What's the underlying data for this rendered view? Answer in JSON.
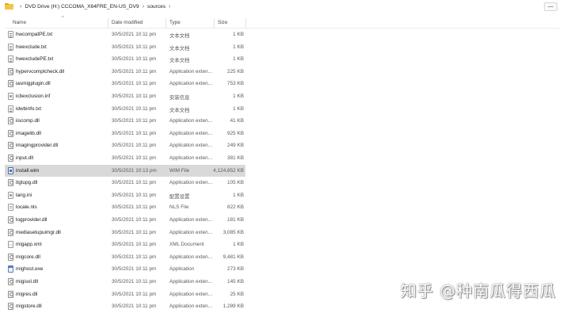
{
  "breadcrumb": {
    "items": [
      "DVD Drive (H:) CCCOMA_X64FRE_EN-US_DV9",
      "sources"
    ]
  },
  "window_buttons": [
    "—"
  ],
  "columns": {
    "name": "Name",
    "date": "Date modified",
    "type": "Type",
    "size": "Size"
  },
  "files": [
    {
      "name": "hwcompatPE.txt",
      "date": "30/5/2021 10:11 pm",
      "type": "文本文档",
      "size": "1 KB",
      "icon": "txt"
    },
    {
      "name": "hwexclude.txt",
      "date": "30/5/2021 10:11 pm",
      "type": "文本文档",
      "size": "1 KB",
      "icon": "txt"
    },
    {
      "name": "hwexcludePE.txt",
      "date": "30/5/2021 10:11 pm",
      "type": "文本文档",
      "size": "1 KB",
      "icon": "txt"
    },
    {
      "name": "hypervcomplcheck.dll",
      "date": "30/5/2021 10:11 pm",
      "type": "Application exten...",
      "size": "225 KB",
      "icon": "dll"
    },
    {
      "name": "iasmigplugin.dll",
      "date": "30/5/2021 10:11 pm",
      "type": "Application exten...",
      "size": "753 KB",
      "icon": "dll"
    },
    {
      "name": "icbexclusion.inf",
      "date": "30/5/2021 10:11 pm",
      "type": "安装信息",
      "size": "1 KB",
      "icon": "ini"
    },
    {
      "name": "idwbinfo.txt",
      "date": "30/5/2021 10:11 pm",
      "type": "文本文档",
      "size": "1 KB",
      "icon": "txt"
    },
    {
      "name": "iiscomp.dll",
      "date": "30/5/2021 10:11 pm",
      "type": "Application exten...",
      "size": "41 KB",
      "icon": "dll"
    },
    {
      "name": "imagelib.dll",
      "date": "30/5/2021 10:11 pm",
      "type": "Application exten...",
      "size": "925 KB",
      "icon": "dll"
    },
    {
      "name": "imagingprovider.dll",
      "date": "30/5/2021 10:11 pm",
      "type": "Application exten...",
      "size": "249 KB",
      "icon": "dll"
    },
    {
      "name": "input.dll",
      "date": "30/5/2021 10:11 pm",
      "type": "Application exten...",
      "size": "381 KB",
      "icon": "dll"
    },
    {
      "name": "install.wim",
      "date": "30/5/2021 10:13 pm",
      "type": "WIM File",
      "size": "4,124,652 KB",
      "icon": "wim",
      "selected": true
    },
    {
      "name": "itgtupg.dll",
      "date": "30/5/2021 10:11 pm",
      "type": "Application exten...",
      "size": "105 KB",
      "icon": "dll"
    },
    {
      "name": "lang.ini",
      "date": "30/5/2021 10:11 pm",
      "type": "配置设置",
      "size": "1 KB",
      "icon": "ini"
    },
    {
      "name": "locale.nls",
      "date": "30/5/2021 10:11 pm",
      "type": "NLS File",
      "size": "822 KB",
      "icon": "nls"
    },
    {
      "name": "logprovider.dll",
      "date": "30/5/2021 10:11 pm",
      "type": "Application exten...",
      "size": "181 KB",
      "icon": "dll"
    },
    {
      "name": "mediasetupuimgr.dll",
      "date": "30/5/2021 10:11 pm",
      "type": "Application exten...",
      "size": "3,085 KB",
      "icon": "dll"
    },
    {
      "name": "migapp.xml",
      "date": "30/5/2021 10:11 pm",
      "type": "XML Document",
      "size": "1 KB",
      "icon": "xml"
    },
    {
      "name": "migcore.dll",
      "date": "30/5/2021 10:11 pm",
      "type": "Application exten...",
      "size": "9,481 KB",
      "icon": "dll"
    },
    {
      "name": "mighost.exe",
      "date": "30/5/2021 10:11 pm",
      "type": "Application",
      "size": "273 KB",
      "icon": "exe"
    },
    {
      "name": "migisol.dll",
      "date": "30/5/2021 10:11 pm",
      "type": "Application exten...",
      "size": "145 KB",
      "icon": "dll"
    },
    {
      "name": "migres.dll",
      "date": "30/5/2021 10:11 pm",
      "type": "Application exten...",
      "size": "25 KB",
      "icon": "dll"
    },
    {
      "name": "migstore.dll",
      "date": "30/5/2021 10:11 pm",
      "type": "Application exten...",
      "size": "1,289 KB",
      "icon": "dll"
    }
  ],
  "watermark": "知乎 @种南瓜得西瓜"
}
